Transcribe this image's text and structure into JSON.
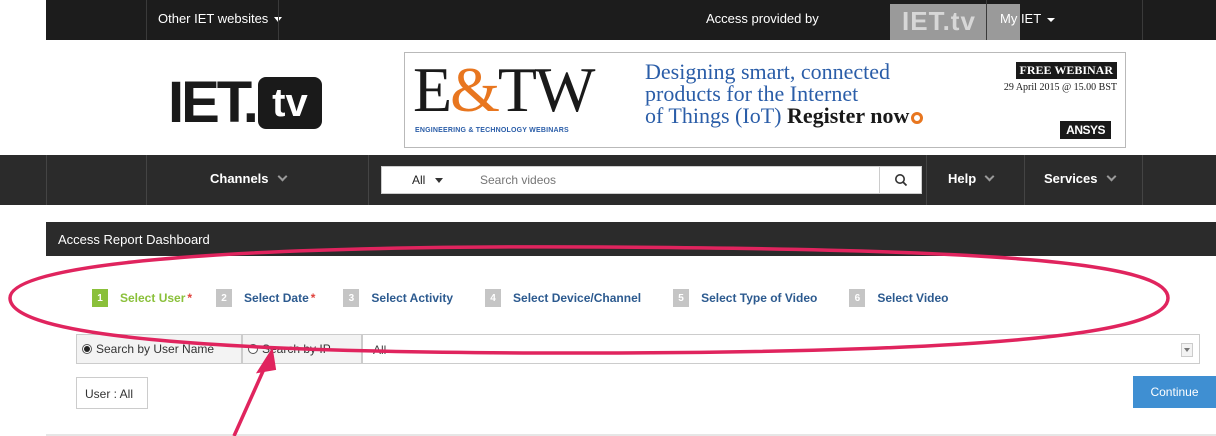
{
  "topbar": {
    "other_sites": "Other IET websites",
    "access_provided_by": "Access provided by",
    "access_logo": "IET.tv",
    "my_iet": "My IET"
  },
  "header": {
    "logo_text": "IET.",
    "logo_tv": "tv",
    "banner": {
      "etw_logo": "E&TW",
      "etw_sub": "ENGINEERING & TECHNOLOGY WEBINARS",
      "line1": "Designing smart, connected",
      "line2": "products for the Internet",
      "line3": "of Things (IoT)",
      "cta": "Register now",
      "webinar_tag": "FREE WEBINAR",
      "webinar_date": "29 April 2015 @ 15.00 BST",
      "sponsor": "ANSYS"
    }
  },
  "nav": {
    "channels": "Channels",
    "search_scope": "All",
    "search_placeholder": "Search videos",
    "help": "Help",
    "services": "Services"
  },
  "dashboard": {
    "title": "Access Report Dashboard",
    "steps": [
      {
        "num": "1",
        "label": "Select User",
        "required": "*"
      },
      {
        "num": "2",
        "label": "Select Date",
        "required": "*"
      },
      {
        "num": "3",
        "label": "Select Activity",
        "required": ""
      },
      {
        "num": "4",
        "label": "Select Device/Channel",
        "required": ""
      },
      {
        "num": "5",
        "label": "Select Type of Video",
        "required": ""
      },
      {
        "num": "6",
        "label": "Select Video",
        "required": ""
      }
    ],
    "search_by_name": "Search by User Name",
    "search_by_ip": "Search by IP",
    "select_value": "All",
    "user_summary": "User : All",
    "continue": "Continue"
  },
  "colors": {
    "active_step": "#8ac03a",
    "step_text": "#2c5a8f",
    "annotation": "#e0245e",
    "continue": "#3f8fd2"
  }
}
